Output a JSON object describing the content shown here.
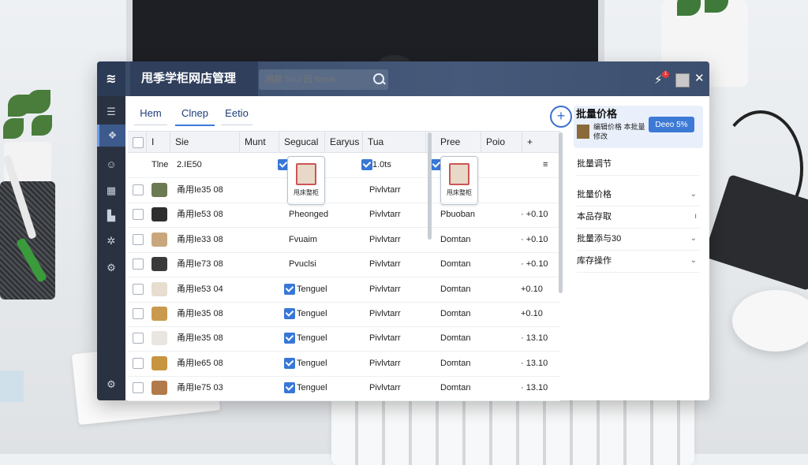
{
  "window": {
    "title": "甩季学柜网店管理",
    "logo_text": "≋",
    "search_placeholder": "溯晨 Sεω 园 tiεnal",
    "notification_count": "1"
  },
  "sidebar": {
    "icons": [
      "menu-icon",
      "box-icon",
      "users-icon",
      "grid-icon",
      "store-icon",
      "star-icon",
      "gear-icon",
      "settings-icon"
    ]
  },
  "tabs": [
    {
      "label": "Hem",
      "active": false
    },
    {
      "label": "Clnep",
      "active": true
    },
    {
      "label": "Eetio",
      "active": false
    }
  ],
  "table": {
    "headers": [
      "I",
      "Sie",
      "Munt",
      "Segucal",
      "Earyus",
      "Tua",
      "Pree",
      "Poio",
      "+"
    ],
    "first_row": {
      "col1": "Tlne",
      "col2": "2.IE50",
      "col5": "1.0ts",
      "menu": "≡"
    },
    "popup_left_label": "甩床整柜",
    "popup_right_label": "甩床整柜",
    "rows": [
      {
        "name": "甬用Ie35 08",
        "seg": "",
        "seg_checked": false,
        "ear": "Pivlvtarr",
        "pree": "",
        "poio": ""
      },
      {
        "name": "甬用Ie53 08",
        "seg": "Pheonged",
        "seg_checked": false,
        "ear": "Pivlvtarr",
        "pree": "Pbuoban",
        "poio": "· +0.10"
      },
      {
        "name": "甬用Ie33 08",
        "seg": "Fvuaim",
        "seg_checked": false,
        "ear": "Pivlvtarr",
        "pree": "Domtan",
        "poio": "· +0.10"
      },
      {
        "name": "甬用Ie73 08",
        "seg": "Pvuclsi",
        "seg_checked": false,
        "ear": "Pivlvtarr",
        "pree": "Domtan",
        "poio": "· +0.10"
      },
      {
        "name": "甬用Ie53 04",
        "seg": "Tenguel",
        "seg_checked": true,
        "ear": "Pivlvtarr",
        "pree": "Domtan",
        "poio": "+0.10"
      },
      {
        "name": "甬用Ie35 08",
        "seg": "Tenguel",
        "seg_checked": true,
        "ear": "Pivlvtarr",
        "pree": "Domtan",
        "poio": "+0.10"
      },
      {
        "name": "甬用Ie35 08",
        "seg": "Tenguel",
        "seg_checked": true,
        "ear": "Pivlvtarr",
        "pree": "Domtan",
        "poio": "· 13.10"
      },
      {
        "name": "甬用Ie65 08",
        "seg": "Tenguel",
        "seg_checked": true,
        "ear": "Pivlvtarr",
        "pree": "Domtan",
        "poio": "· 13.10"
      },
      {
        "name": "甬用Ie75 03",
        "seg": "Tenguel",
        "seg_checked": true,
        "ear": "Pivlvtarr",
        "pree": "Domtan",
        "poio": "· 13.10"
      }
    ]
  },
  "right_panel": {
    "title": "批量价格",
    "sub_text": "编辑价格 本批量修改",
    "button_label": "Deeo 5%",
    "items": [
      {
        "label": "批量调节",
        "chevron": ""
      },
      {
        "label": "批量价格",
        "chevron": "⌄"
      },
      {
        "label": "本品存取",
        "chevron": "ı"
      },
      {
        "label": "批量添与30",
        "chevron": "⌄"
      },
      {
        "label": "库存操作",
        "chevron": "⌄"
      }
    ]
  },
  "colors": {
    "titlebar": "#3a4c6a",
    "sidebar": "#2a3242",
    "accent": "#3877d6"
  }
}
